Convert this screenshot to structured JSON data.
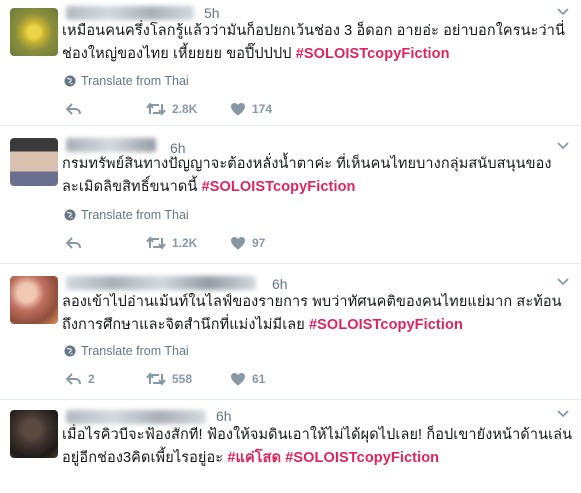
{
  "colors": {
    "hashtag": "#e0245e",
    "meta": "#657786",
    "icon": "#8899a6"
  },
  "tweets": [
    {
      "time": "5h",
      "text": "เหมือนคนครึ่งโลกรู้แล้วว่ามันก็อปยกเว้นช่อง 3 อ็ดอก อายอ่ะ อย่าบอกใครนะว่านี่ช่องใหญ่ของไทย เหี้ยยยย ขอปี๊ปปปป ",
      "hashtag": "#SOLOISTcopyFiction",
      "translate": "Translate from Thai",
      "retweets": "2.8K",
      "likes": "174",
      "replies": ""
    },
    {
      "time": "6h",
      "text": "กรมทรัพย์สินทางปัญญาจะต้องหลั่งน้ำตาค่ะ ที่เห็นคนไทยบางกลุ่มสนับสนุนของละเมิดลิขสิทธิ์ขนาดนี้ ",
      "hashtag": "#SOLOISTcopyFiction",
      "translate": "Translate from Thai",
      "retweets": "1.2K",
      "likes": "97",
      "replies": ""
    },
    {
      "time": "6h",
      "text": "ลองเข้าไปอ่านเม้นท์ในไลฟ์ของรายการ พบว่าทัศนคติของคนไทยแย่มาก สะท้อนถึงการศึกษาและจิตสำนึกที่แม่งไม่มีเลย ",
      "hashtag": "#SOLOISTcopyFiction",
      "translate": "Translate from Thai",
      "retweets": "558",
      "likes": "61",
      "replies": "2"
    },
    {
      "time": "6h",
      "text": "เมื่อไรคิวบีจะฟ้องสักที! ฟ้องให้จมดินเอาให้ไม่ได้ผุดไปเลย! ก็อปเขายังหน้าด้านเล่นอยู่อีกช่อง3คิดเพี้ยไรอยู่อะ ",
      "hashtag": "#แค่โสด #SOLOISTcopyFiction",
      "translate": "",
      "retweets": "",
      "likes": "",
      "replies": ""
    }
  ]
}
